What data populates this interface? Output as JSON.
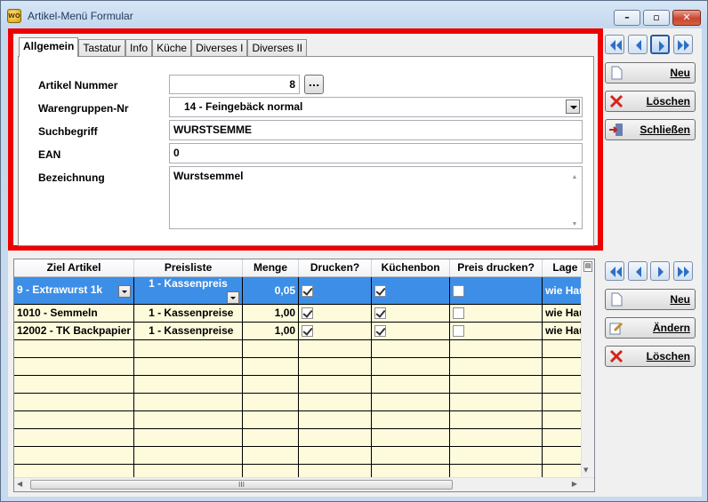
{
  "window": {
    "title": "Artikel-Menü Formular",
    "icon_text": "WO",
    "controls": {
      "minimize": "–",
      "maximize": "▫",
      "close": "✕"
    }
  },
  "tabs": [
    {
      "label": "Allgemein",
      "active": true
    },
    {
      "label": "Tastatur",
      "active": false
    },
    {
      "label": "Info",
      "active": false
    },
    {
      "label": "Küche",
      "active": false
    },
    {
      "label": "Diverses I",
      "active": false
    },
    {
      "label": "Diverses II",
      "active": false
    }
  ],
  "form": {
    "artikel_nummer": {
      "label": "Artikel Nummer",
      "value": "8",
      "lookup_button": "..."
    },
    "warengruppen": {
      "label": "Warengruppen-Nr",
      "value": "14 - Feingebäck normal"
    },
    "suchbegriff": {
      "label": "Suchbegriff",
      "value": "WURSTSEMME"
    },
    "ean": {
      "label": "EAN",
      "value": "0"
    },
    "bezeichnung": {
      "label": "Bezeichnung",
      "value": "Wurstsemmel"
    }
  },
  "top_actions": {
    "neu": "Neu",
    "loeschen": "Löschen",
    "schliessen": "Schließen"
  },
  "bottom_actions": {
    "neu": "Neu",
    "aendern": "Ändern",
    "loeschen": "Löschen"
  },
  "grid": {
    "columns": [
      "Ziel Artikel",
      "Preisliste",
      "Menge",
      "Drucken?",
      "Küchenbon",
      "Preis drucken?",
      "Lage"
    ],
    "rows": [
      {
        "ziel": "9 - Extrawurst 1k",
        "preisliste": "1 - Kassenpreis",
        "menge": "0,05",
        "drucken": true,
        "kuechenbon": true,
        "preis_drucken": false,
        "lage": "wie Hau",
        "selected": true
      },
      {
        "ziel": "1010 - Semmeln",
        "preisliste": "1 - Kassenpreise",
        "menge": "1,00",
        "drucken": true,
        "kuechenbon": true,
        "preis_drucken": false,
        "lage": "wie Hau",
        "selected": false
      },
      {
        "ziel": "12002 - TK Backpapier",
        "preisliste": "1 - Kassenpreise",
        "menge": "1,00",
        "drucken": true,
        "kuechenbon": true,
        "preis_drucken": false,
        "lage": "wie Hau",
        "selected": false
      }
    ],
    "empty_rows": 8,
    "hscroll_grip": "III"
  },
  "colors": {
    "accent_red": "#ee0000",
    "selection": "#3d8ee6",
    "row_bg": "#fdfbdc"
  }
}
